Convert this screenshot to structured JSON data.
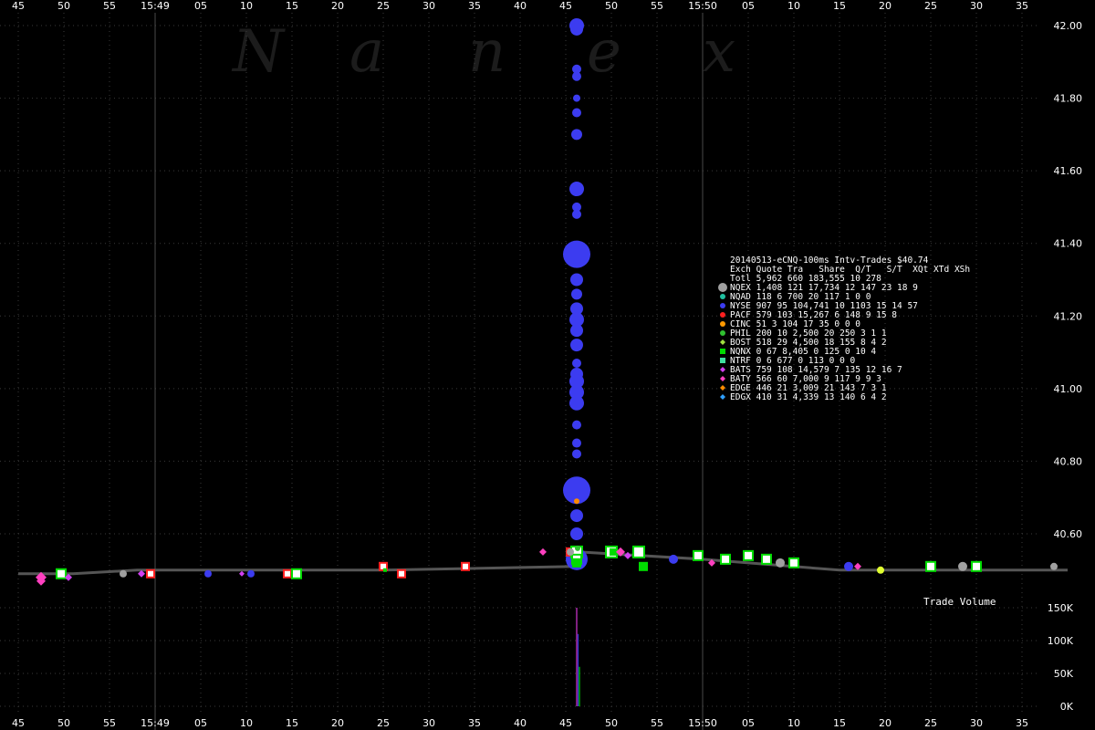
{
  "chart_data": {
    "type": "scatter",
    "title": "20140513-eCNQ-100ms Intv-Trades $40.74",
    "watermark": "Nanex",
    "x_ticks_top": [
      "45",
      "50",
      "55",
      "15:49",
      "05",
      "10",
      "15",
      "20",
      "25",
      "30",
      "35",
      "40",
      "45",
      "50",
      "55",
      "15:50",
      "05",
      "10",
      "15",
      "20",
      "25",
      "30",
      "35"
    ],
    "x_ticks_bottom": [
      "45",
      "50",
      "55",
      "15:49",
      "05",
      "10",
      "15",
      "20",
      "25",
      "30",
      "35",
      "40",
      "45",
      "50",
      "55",
      "15:50",
      "05",
      "10",
      "15",
      "20",
      "25",
      "30",
      "35"
    ],
    "x_range_seconds": [
      -15,
      35
    ],
    "minute_lines_seconds": [
      0,
      60
    ],
    "y_ticks": [
      "42.00",
      "41.80",
      "41.60",
      "41.40",
      "41.20",
      "41.00",
      "40.80",
      "40.60"
    ],
    "ylim": [
      40.45,
      42.05
    ],
    "volume_panel": {
      "label": "Trade Volume",
      "y_ticks": [
        "150K",
        "100K",
        "50K",
        "0K"
      ],
      "ylim": [
        0,
        170000
      ],
      "bars": [
        {
          "t": 41.2,
          "v": 150000,
          "color": "#ff40ff"
        },
        {
          "t": 41.35,
          "v": 110000,
          "color": "#3c3cf0"
        },
        {
          "t": 41.5,
          "v": 60000,
          "color": "#00ff00"
        }
      ]
    },
    "nbbo_line": [
      [
        -20,
        40.49
      ],
      [
        -14,
        40.49
      ],
      [
        -7,
        40.5
      ],
      [
        0,
        40.5
      ],
      [
        20,
        40.5
      ],
      [
        41,
        40.51
      ],
      [
        41.5,
        40.55
      ],
      [
        55,
        40.53
      ],
      [
        70,
        40.5
      ],
      [
        95,
        40.5
      ]
    ],
    "legend": {
      "header": "Exch Quote Tra   Share  Q/T   S/T  XQt XTd XSh",
      "rows": [
        {
          "symbol": "none",
          "color": "#000000",
          "text": "Totl 5,962 660 183,555  10  278"
        },
        {
          "symbol": "circle-large",
          "color": "#a0a0a0",
          "text": "NQEX 1,408 121  17,734  12  147  23  18   9"
        },
        {
          "symbol": "circle",
          "color": "#20c0a0",
          "text": "NQAD   118   6     700  20  117   1   0   0"
        },
        {
          "symbol": "circle",
          "color": "#3c3cf0",
          "text": "NYSE   907  95 104,741  10 1103  15  14  57"
        },
        {
          "symbol": "circle",
          "color": "#ff2020",
          "text": "PACF   579 103  15,267   6  148   9  15   8"
        },
        {
          "symbol": "circle",
          "color": "#ff9900",
          "text": "CINC    51   3     104  17   35   0   0   0"
        },
        {
          "symbol": "circle",
          "color": "#30c030",
          "text": "PHIL   200  10   2,500  20  250   3   1   1"
        },
        {
          "symbol": "diamond",
          "color": "#a0e040",
          "text": "BOST   518  29   4,500  18  155   8   4   2"
        },
        {
          "symbol": "square",
          "color": "#00dd00",
          "text": "NQNX     0  67   8,405   0  125   0  10   4"
        },
        {
          "symbol": "square",
          "color": "#40e0a0",
          "text": "NTRF     0   6     677   0  113   0   0   0"
        },
        {
          "symbol": "diamond",
          "color": "#d040f0",
          "text": "BATS   759 108  14,579   7  135  12  16   7"
        },
        {
          "symbol": "diamond",
          "color": "#ff40c0",
          "text": "BATY   566  60   7,000   9  117   9   9   3"
        },
        {
          "symbol": "diamond",
          "color": "#ff8c00",
          "text": "EDGE   446  21   3,009  21  143   7   3   1"
        },
        {
          "symbol": "diamond",
          "color": "#30a0ff",
          "text": "EDGX   410  31   4,339  13  140   6   4   2"
        }
      ]
    },
    "series": [
      {
        "name": "NYSE",
        "color": "#3c3cf0",
        "shape": "circle",
        "points": [
          [
            41.2,
            42.0,
            8
          ],
          [
            41.2,
            41.99,
            7
          ],
          [
            41.2,
            41.88,
            5
          ],
          [
            41.2,
            41.86,
            5
          ],
          [
            41.2,
            41.8,
            4
          ],
          [
            41.2,
            41.76,
            5
          ],
          [
            41.2,
            41.7,
            6
          ],
          [
            41.2,
            41.55,
            8
          ],
          [
            41.2,
            41.5,
            5
          ],
          [
            41.2,
            41.48,
            5
          ],
          [
            41.2,
            41.37,
            15
          ],
          [
            41.2,
            41.3,
            7
          ],
          [
            41.2,
            41.26,
            6
          ],
          [
            41.2,
            41.22,
            7
          ],
          [
            41.2,
            41.19,
            8
          ],
          [
            41.2,
            41.16,
            7
          ],
          [
            41.2,
            41.12,
            7
          ],
          [
            41.2,
            41.07,
            5
          ],
          [
            41.2,
            41.04,
            7
          ],
          [
            41.2,
            41.02,
            8
          ],
          [
            41.2,
            40.99,
            8
          ],
          [
            41.2,
            40.96,
            8
          ],
          [
            41.2,
            40.9,
            5
          ],
          [
            41.2,
            40.85,
            5
          ],
          [
            41.2,
            40.82,
            5
          ],
          [
            41.2,
            40.72,
            15
          ],
          [
            41.2,
            40.65,
            7
          ],
          [
            41.2,
            40.6,
            7
          ],
          [
            41.2,
            40.53,
            12
          ],
          [
            51.8,
            40.53,
            5
          ],
          [
            71,
            40.51,
            5
          ],
          [
            0.8,
            40.49,
            4
          ],
          [
            5.5,
            40.49,
            4
          ]
        ]
      },
      {
        "name": "PACF",
        "color": "#ff2020",
        "shape": "square-hollow",
        "points": [
          [
            -5.5,
            40.49,
            4
          ],
          [
            9.5,
            40.49,
            4
          ],
          [
            22,
            40.49,
            4
          ],
          [
            29,
            40.51,
            4
          ],
          [
            40.5,
            40.55,
            4
          ],
          [
            20,
            40.51,
            4
          ]
        ]
      },
      {
        "name": "NQNX",
        "color": "#00dd00",
        "shape": "square-hollow",
        "points": [
          [
            -15.3,
            40.49,
            5
          ],
          [
            41.2,
            40.55,
            6
          ],
          [
            41.2,
            40.53,
            5
          ],
          [
            45,
            40.55,
            6
          ],
          [
            48,
            40.55,
            6
          ],
          [
            54.5,
            40.54,
            5
          ],
          [
            57.5,
            40.53,
            5
          ],
          [
            60,
            40.54,
            5
          ],
          [
            62,
            40.53,
            5
          ],
          [
            65,
            40.52,
            5
          ],
          [
            80,
            40.51,
            5
          ],
          [
            85,
            40.51,
            5
          ],
          [
            10.5,
            40.49,
            5
          ]
        ]
      },
      {
        "name": "NQNX-fill",
        "color": "#00dd00",
        "shape": "square",
        "points": [
          [
            48.5,
            40.51,
            5
          ],
          [
            41.2,
            40.52,
            5
          ],
          [
            45.2,
            40.55,
            4
          ]
        ]
      },
      {
        "name": "NQEX",
        "color": "#a0a0a0",
        "shape": "circle",
        "points": [
          [
            -8.5,
            40.49,
            4
          ],
          [
            63.5,
            40.52,
            5
          ],
          [
            93.5,
            40.51,
            4
          ],
          [
            83.5,
            40.51,
            5
          ],
          [
            40.5,
            40.55,
            4
          ]
        ]
      },
      {
        "name": "BATY",
        "color": "#ff40c0",
        "shape": "diamond",
        "points": [
          [
            -17.5,
            40.48,
            6
          ],
          [
            -17.5,
            40.47,
            5
          ],
          [
            46,
            40.55,
            5
          ],
          [
            56,
            40.52,
            4
          ],
          [
            72,
            40.51,
            4
          ],
          [
            37.5,
            40.55,
            4
          ]
        ]
      },
      {
        "name": "BATS",
        "color": "#d040f0",
        "shape": "diamond",
        "points": [
          [
            -6.5,
            40.49,
            4
          ],
          [
            46.8,
            40.54,
            4
          ],
          [
            -14.5,
            40.48,
            4
          ],
          [
            4.5,
            40.49,
            3
          ]
        ]
      },
      {
        "name": "EDGE",
        "color": "#ff8c00",
        "shape": "circle",
        "points": [
          [
            41.2,
            40.69,
            3
          ]
        ]
      },
      {
        "name": "PHIL",
        "color": "#30c030",
        "shape": "circle",
        "points": [
          [
            41.3,
            40.56,
            3
          ]
        ]
      },
      {
        "name": "BOST",
        "color": "#e0ff30",
        "shape": "circle",
        "points": [
          [
            74.5,
            40.5,
            4
          ]
        ]
      },
      {
        "name": "NQNX-small",
        "color": "#00dd00",
        "shape": "square",
        "points": [
          [
            20.2,
            40.5,
            2
          ]
        ]
      }
    ]
  }
}
